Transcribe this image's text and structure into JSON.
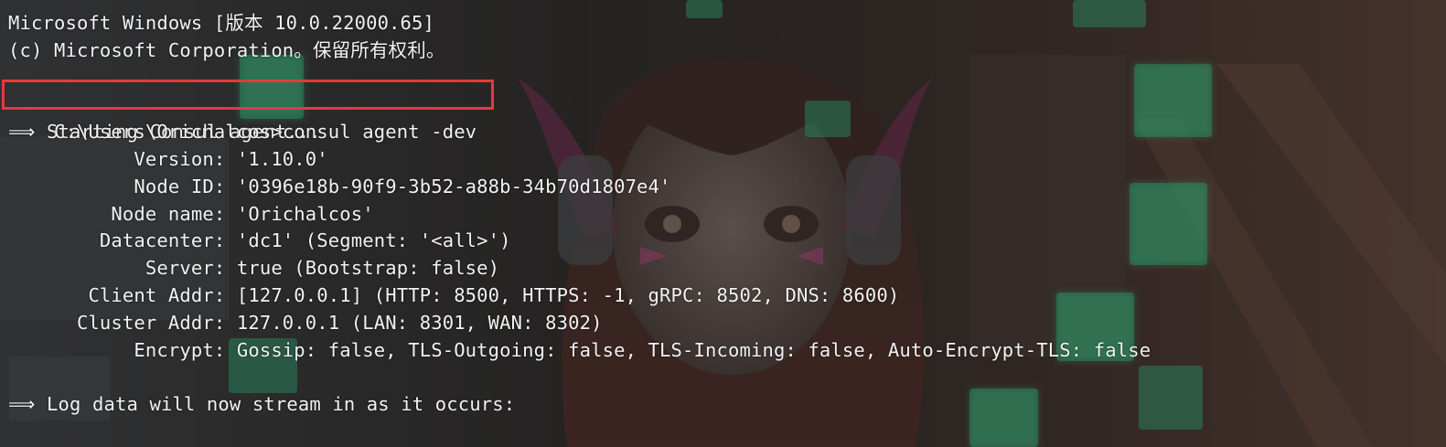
{
  "terminal": {
    "header_line_1": "Microsoft Windows [版本 10.0.22000.65]",
    "header_line_2": "(c) Microsoft Corporation。保留所有权利。",
    "prompt": "C:\\Users\\Orichalcos>",
    "command": "consul agent -dev",
    "output": [
      "⟹ Starting Consul agent...",
      "           Version: '1.10.0'",
      "           Node ID: '0396e18b-90f9-3b52-a88b-34b70d1807e4'",
      "         Node name: 'Orichalcos'",
      "        Datacenter: 'dc1' (Segment: '<all>')",
      "            Server: true (Bootstrap: false)",
      "       Client Addr: [127.0.0.1] (HTTP: 8500, HTTPS: -1, gRPC: 8502, DNS: 8600)",
      "      Cluster Addr: 127.0.0.1 (LAN: 8301, WAN: 8302)",
      "           Encrypt: Gossip: false, TLS-Outgoing: false, TLS-Incoming: false, Auto-Encrypt-TLS: false",
      "",
      "⟹ Log data will now stream in as it occurs:"
    ]
  },
  "colors": {
    "text": "#f2f2f2",
    "highlight_box": "#e8383d",
    "background": "#2c2a29",
    "accent_green": "#2fb57a"
  }
}
